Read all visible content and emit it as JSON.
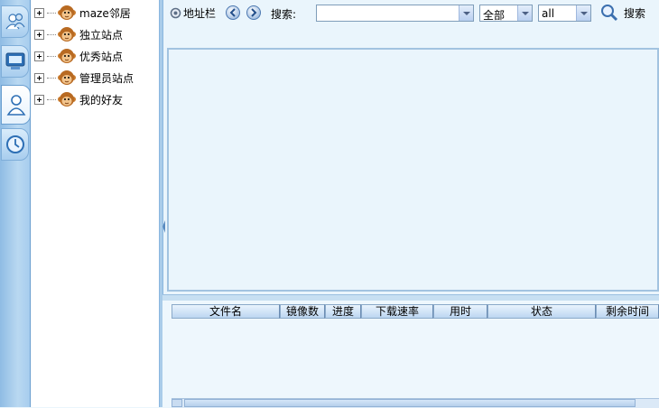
{
  "sidebar_tabs": [
    {
      "icon": "friends-icon"
    },
    {
      "icon": "computer-icon"
    },
    {
      "icon": "user-icon"
    },
    {
      "icon": "clock-icon"
    }
  ],
  "tree": {
    "items": [
      {
        "label": "maze邻居",
        "icon": "monkey-icon"
      },
      {
        "label": "独立站点",
        "icon": "monkey-icon"
      },
      {
        "label": "优秀站点",
        "icon": "monkey-icon"
      },
      {
        "label": "管理员站点",
        "icon": "monkey-icon"
      },
      {
        "label": "我的好友",
        "icon": "monkey-icon"
      }
    ]
  },
  "toolbar": {
    "address_label": "地址栏",
    "search_label": "搜索:",
    "search_value": "",
    "scope_value": "全部",
    "type_value": "all",
    "search_button": "搜索"
  },
  "downloads": {
    "columns": [
      "文件名",
      "镜像数",
      "进度",
      "下载速率",
      "用时",
      "状态",
      "剩余时间"
    ],
    "rows": []
  },
  "colors": {
    "accent": "#8fbce4",
    "panel_bg": "#eaf5fc",
    "border": "#a2c3e0"
  }
}
